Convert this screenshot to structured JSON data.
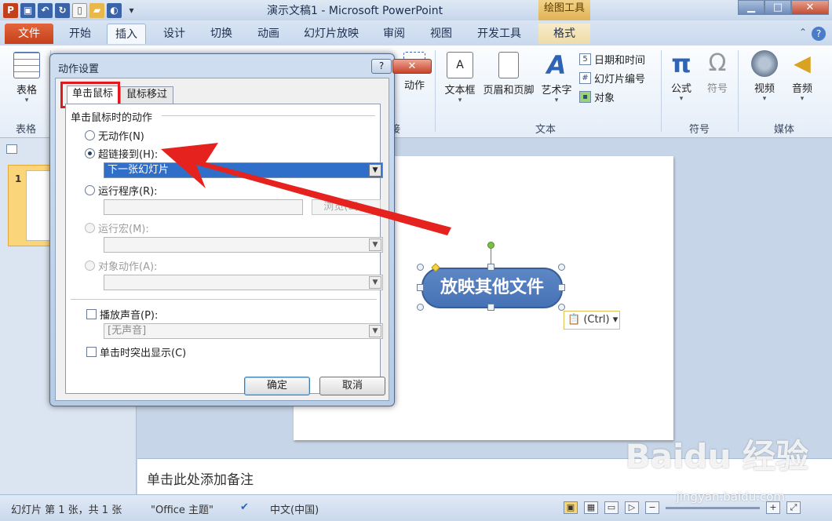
{
  "window": {
    "title": "演示文稿1 - Microsoft PowerPoint",
    "context_tab_group": "绘图工具"
  },
  "tabs": [
    {
      "label": "文件"
    },
    {
      "label": "开始"
    },
    {
      "label": "插入"
    },
    {
      "label": "设计"
    },
    {
      "label": "切换"
    },
    {
      "label": "动画"
    },
    {
      "label": "幻灯片放映"
    },
    {
      "label": "审阅"
    },
    {
      "label": "视图"
    },
    {
      "label": "开发工具"
    },
    {
      "label": "格式"
    }
  ],
  "ribbon": {
    "table_label": "表格",
    "group_table": "表格",
    "group_link_partial": "接",
    "action_label": "动作",
    "textbox_label": "文本框",
    "header_footer_label": "页眉和页脚",
    "wordart_label": "艺术字",
    "datetime_label": "日期和时间",
    "slide_number_label": "幻灯片编号",
    "object_label": "对象",
    "group_text": "文本",
    "formula_label": "公式",
    "symbol_label": "符号",
    "group_symbol": "符号",
    "video_label": "视频",
    "audio_label": "音频",
    "group_media": "媒体"
  },
  "thumbs": {
    "slide_number": "1"
  },
  "slide": {
    "shape_text": "放映其他文件",
    "ctrl_tag": "(Ctrl)"
  },
  "notes": {
    "placeholder": "单击此处添加备注"
  },
  "status": {
    "slide_info": "幻灯片 第 1 张，共 1 张",
    "theme": "\"Office 主题\"",
    "language": "中文(中国)"
  },
  "dialog": {
    "title": "动作设置",
    "tab_click": "单击鼠标",
    "tab_hover": "鼠标移过",
    "section_title": "单击鼠标时的动作",
    "opt_none": "无动作(N)",
    "opt_hyperlink": "超链接到(H):",
    "hyperlink_value": "下一张幻灯片",
    "opt_run_program": "运行程序(R):",
    "browse_label": "浏览(B)...",
    "opt_run_macro": "运行宏(M):",
    "opt_object_action": "对象动作(A):",
    "play_sound": "播放声音(P):",
    "sound_value": "[无声音]",
    "highlight": "单击时突出显示(C)",
    "ok": "确定",
    "cancel": "取消"
  },
  "watermark": {
    "brand": "Baidu 经验",
    "url": "jingyan.baidu.com"
  },
  "colors": {
    "accent_red": "#e0191f",
    "shape_fill": "#4a76b9",
    "file_tab": "#d24f25"
  }
}
